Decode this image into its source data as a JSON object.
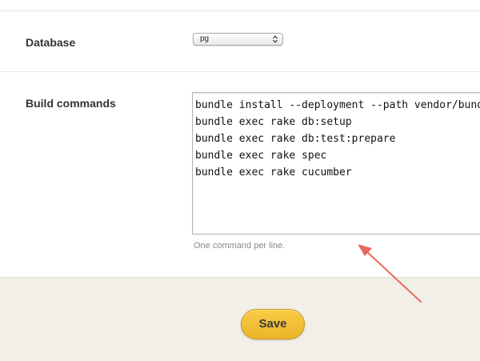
{
  "database": {
    "label": "Database",
    "selected_value": "pg"
  },
  "build": {
    "label": "Build commands",
    "lines": [
      "bundle install --deployment --path vendor/bundle",
      "bundle exec rake db:setup",
      "bundle exec rake db:test:prepare",
      "bundle exec rake spec",
      "bundle exec rake cucumber"
    ],
    "hint": "One command per line."
  },
  "actions": {
    "save_label": "Save"
  },
  "colors": {
    "save_button": "#f0bd33",
    "footer_bg": "#f1efe7",
    "annotation_arrow": "#e8695c"
  },
  "icons": {
    "select_arrows": "up-down-chevron-icon",
    "annotation": "arrow-pointer-icon"
  }
}
